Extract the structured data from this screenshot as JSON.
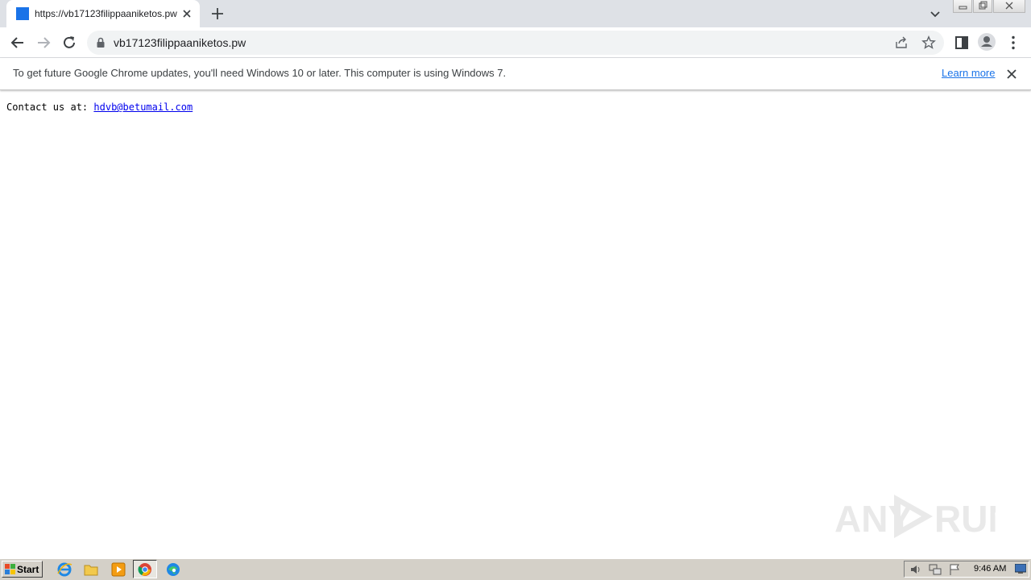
{
  "browser": {
    "tab": {
      "title": "https://vb17123filippaaniketos.pw",
      "favicon_color": "#1a73e8"
    },
    "address_bar": {
      "url": "vb17123filippaaniketos.pw"
    },
    "icons": [
      "back-arrow-icon",
      "forward-arrow-icon",
      "reload-icon",
      "lock-icon",
      "share-icon",
      "star-icon",
      "side-panel-icon",
      "profile-icon",
      "menu-icon"
    ]
  },
  "infobar": {
    "message": "To get future Google Chrome updates, you'll need Windows 10 or later. This computer is using Windows 7.",
    "link": "Learn more"
  },
  "page": {
    "contact_label": "Contact us at:",
    "contact_email": "hdvb@betumail.com"
  },
  "watermark": {
    "text_left": "ANY",
    "text_right": "RUN"
  },
  "taskbar": {
    "start_label": "Start",
    "clock": "9:46 AM",
    "pinned": [
      "internet-explorer-icon",
      "folder-icon",
      "media-player-icon",
      "chrome-icon",
      "edge-icon"
    ]
  }
}
